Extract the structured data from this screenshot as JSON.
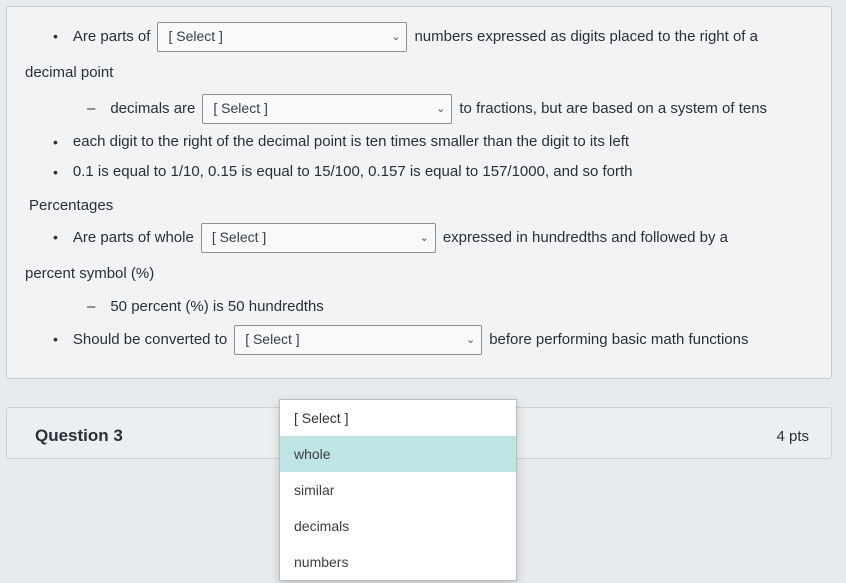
{
  "select_placeholder": "[ Select ]",
  "l1": {
    "pre": "Are parts of",
    "post": "numbers expressed as digits placed to the right of a"
  },
  "l1b": "decimal point",
  "l2": {
    "pre": "decimals are",
    "post": "to fractions, but are based on a system of tens"
  },
  "l3": "each digit to the right of the decimal point is ten times smaller than the digit to its left",
  "l4": "0.1 is equal to 1/10, 0.15 is equal to 15/100, 0.157 is equal to 157/1000, and so forth",
  "sect2": "Percentages",
  "l5": {
    "pre": "Are parts of whole",
    "post": "expressed in hundredths and followed by a"
  },
  "l5b": "percent symbol (%)",
  "l6": "50 percent (%) is 50 hundredths",
  "l7": {
    "pre": "Should be converted to",
    "post": "before performing basic math functions"
  },
  "dropdown": {
    "header": "[ Select ]",
    "opts": [
      "whole",
      "similar",
      "decimals",
      "numbers"
    ],
    "highlighted": 0
  },
  "q3": {
    "title": "Question 3",
    "pts": "4 pts"
  }
}
